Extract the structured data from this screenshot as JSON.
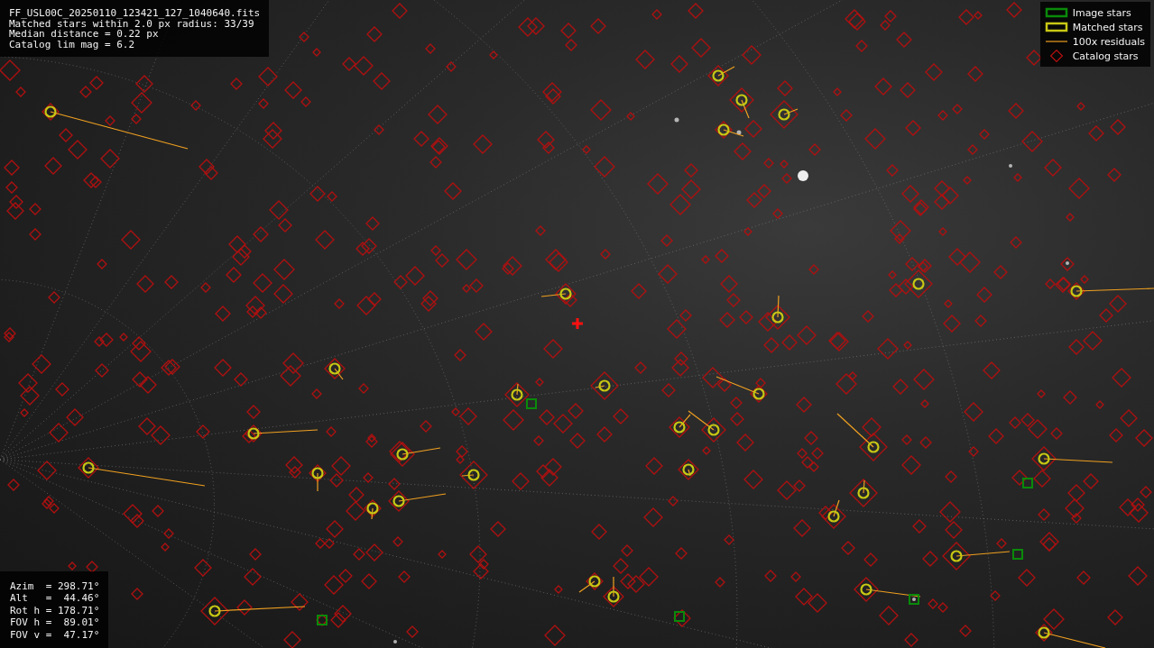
{
  "file_info": {
    "lines": [
      "FF_USL00C_20250110_123421_127_1040640.fits",
      "Matched stars within 2.0 px radius: 33/39",
      "Median distance = 0.22 px",
      "Catalog lim mag = 6.2"
    ]
  },
  "legend": {
    "items": [
      {
        "kind": "image",
        "label": "Image stars"
      },
      {
        "kind": "matched",
        "label": "Matched stars"
      },
      {
        "kind": "residual",
        "label": "100x residuals"
      },
      {
        "kind": "catalog",
        "label": "Catalog stars"
      }
    ]
  },
  "pointing": {
    "lines": [
      "Azim  = 298.71°",
      "Alt   =  44.46°",
      "Rot h = 178.71°",
      "FOV h =  89.01°",
      "FOV v =  47.17°"
    ]
  }
}
